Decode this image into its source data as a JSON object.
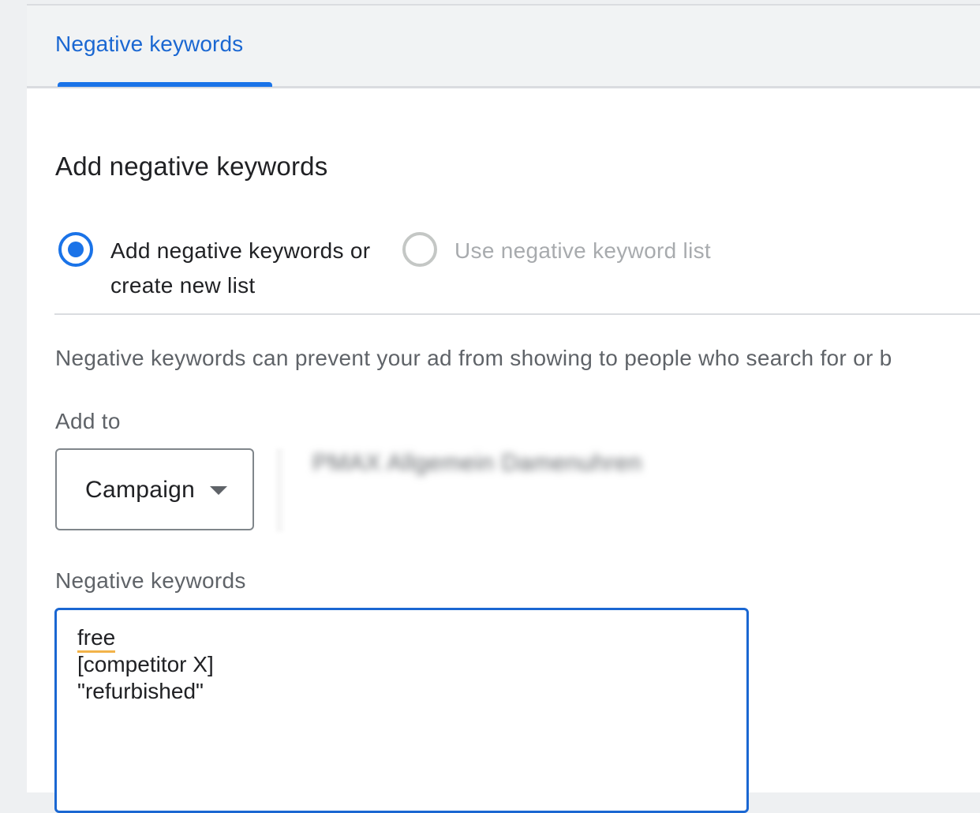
{
  "tabs": [
    {
      "label": "Negative keywords",
      "active": true
    }
  ],
  "heading": "Add negative keywords",
  "radio_options": [
    {
      "label": "Add negative keywords or create new list",
      "checked": true,
      "disabled": false
    },
    {
      "label": "Use negative keyword list",
      "checked": false,
      "disabled": true
    }
  ],
  "description": "Negative keywords can prevent your ad from showing to people who search for or b",
  "add_to": {
    "label": "Add to",
    "selected": "Campaign",
    "campaign_name": "PMAX Allgemein Damenuhren"
  },
  "negative_keywords": {
    "label": "Negative keywords",
    "lines": [
      "free",
      "[competitor X]",
      "\"refurbished\""
    ]
  },
  "colors": {
    "accent": "#1a73e8",
    "tab_text": "#1a67d2",
    "spellcheck_underline": "#f2b34a"
  }
}
